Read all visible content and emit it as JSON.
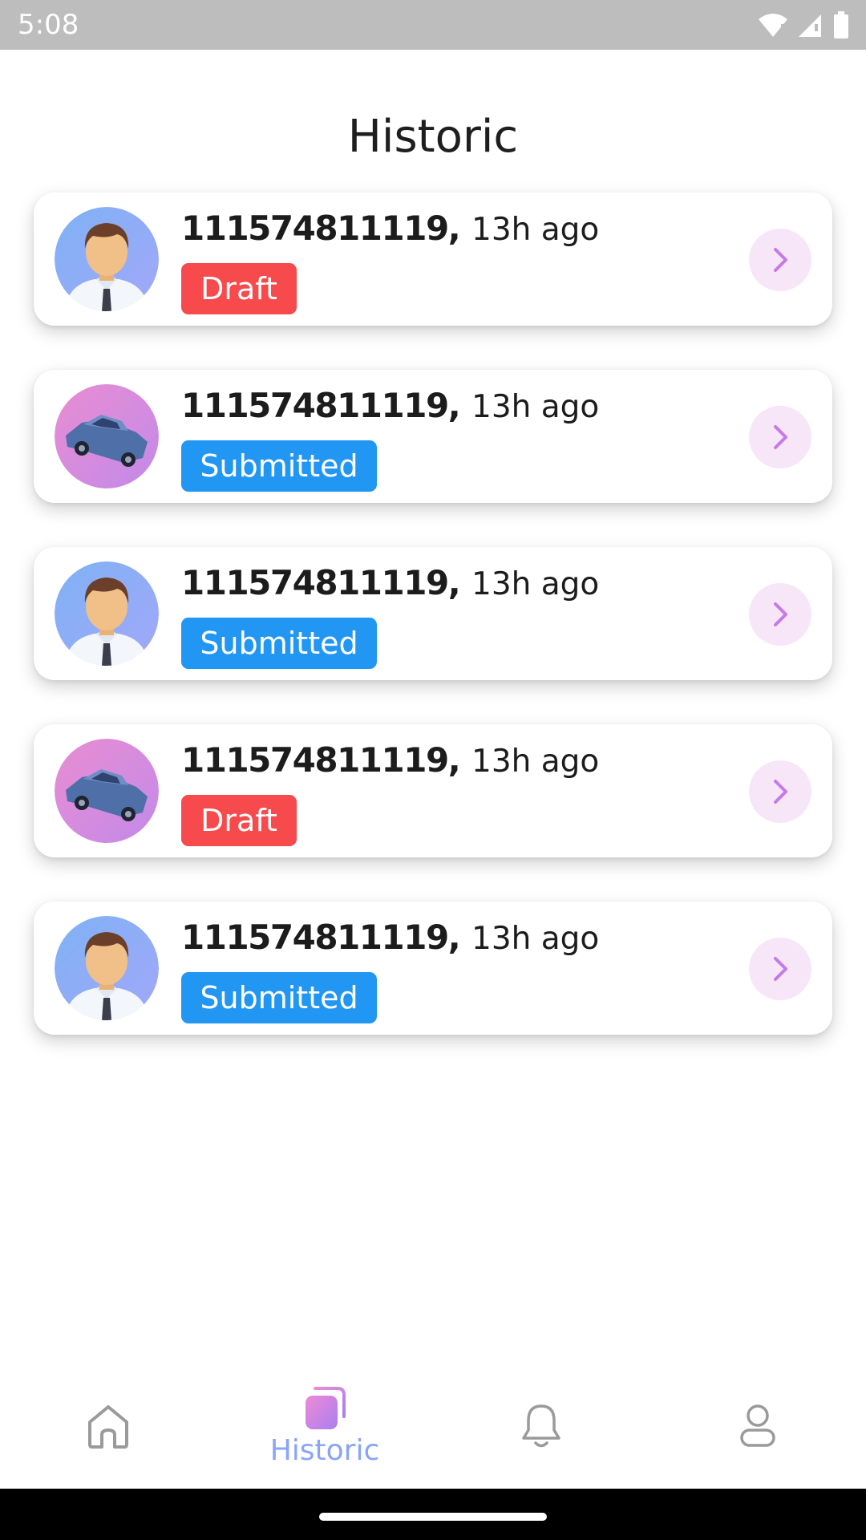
{
  "status_bar": {
    "time": "5:08"
  },
  "page": {
    "title": "Historic"
  },
  "records": [
    {
      "id": "111574811119",
      "separator": ",",
      "time": "13h ago",
      "status": "Draft",
      "status_type": "draft",
      "avatar": "person"
    },
    {
      "id": "111574811119",
      "separator": ",",
      "time": "13h ago",
      "status": "Submitted",
      "status_type": "submitted",
      "avatar": "car"
    },
    {
      "id": "111574811119",
      "separator": ",",
      "time": "13h ago",
      "status": "Submitted",
      "status_type": "submitted",
      "avatar": "person"
    },
    {
      "id": "111574811119",
      "separator": ",",
      "time": "13h ago",
      "status": "Draft",
      "status_type": "draft",
      "avatar": "car"
    },
    {
      "id": "111574811119",
      "separator": ",",
      "time": "13h ago",
      "status": "Submitted",
      "status_type": "submitted",
      "avatar": "person"
    }
  ],
  "nav": {
    "items": [
      {
        "icon": "home-icon",
        "label": "",
        "active": false
      },
      {
        "icon": "cards-icon",
        "label": "Historic",
        "active": true
      },
      {
        "icon": "bell-icon",
        "label": "",
        "active": false
      },
      {
        "icon": "user-icon",
        "label": "",
        "active": false
      }
    ]
  },
  "colors": {
    "draft": "#f74a4c",
    "submitted": "#2196f3",
    "accent": "#8aa4f8",
    "chevron": "#c57ae6"
  }
}
